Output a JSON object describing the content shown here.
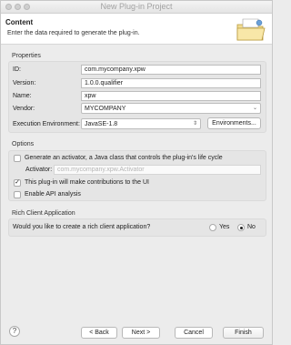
{
  "window": {
    "title": "New Plug-in Project"
  },
  "header": {
    "title": "Content",
    "description": "Enter the data required to generate the plug-in.",
    "icon": "folder-wizard-icon"
  },
  "properties": {
    "section_title": "Properties",
    "id_label": "ID:",
    "id_value": "com.mycompany.xpw",
    "version_label": "Version:",
    "version_value": "1.0.0.qualifier",
    "name_label": "Name:",
    "name_value": "xpw",
    "vendor_label": "Vendor:",
    "vendor_value": "MYCOMPANY",
    "env_label": "Execution Environment:",
    "env_value": "JavaSE-1.8",
    "env_button": "Environments..."
  },
  "options": {
    "section_title": "Options",
    "activator_check_label": "Generate an activator, a Java class that controls the plug-in's life cycle",
    "activator_check_checked": false,
    "activator_label": "Activator:",
    "activator_value": "com.mycompany.xpw.Activator",
    "contrib_label": "This plug-in will make contributions to the UI",
    "contrib_checked": true,
    "api_label": "Enable API analysis",
    "api_checked": false
  },
  "rcp": {
    "section_title": "Rich Client Application",
    "question": "Would you like to create a rich client application?",
    "yes_label": "Yes",
    "no_label": "No",
    "selected": "No"
  },
  "footer": {
    "help": "?",
    "back": "< Back",
    "next": "Next >",
    "cancel": "Cancel",
    "finish": "Finish"
  }
}
